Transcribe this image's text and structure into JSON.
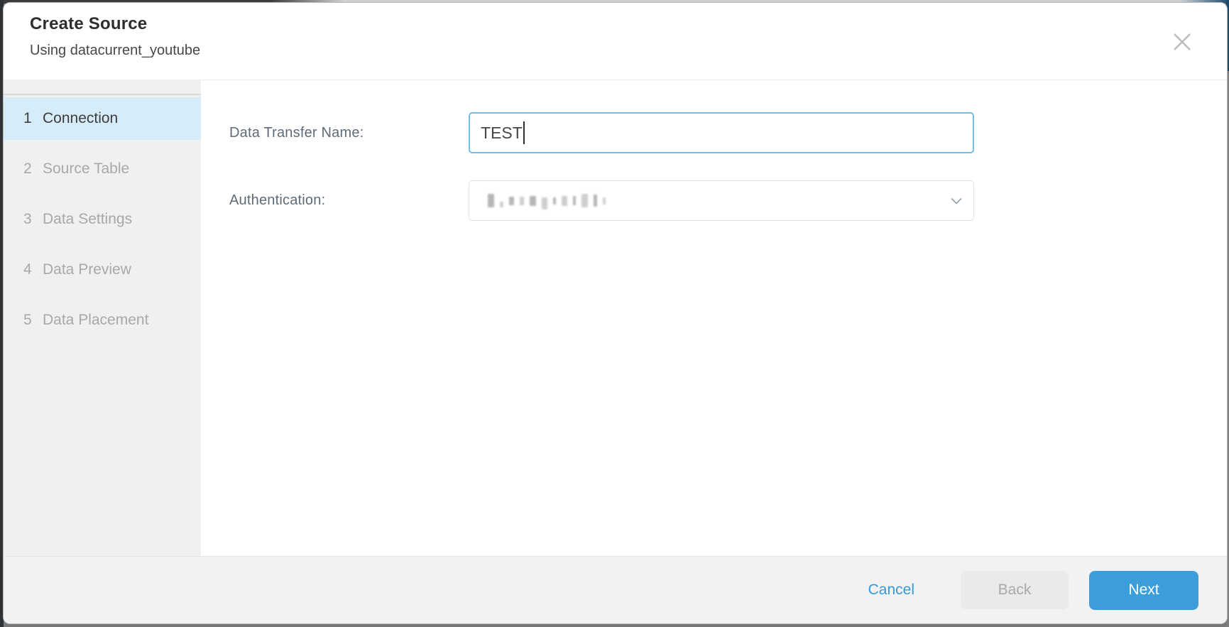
{
  "dialog": {
    "title": "Create Source",
    "subtitle": "Using datacurrent_youtube"
  },
  "steps": [
    {
      "number": "1",
      "label": "Connection",
      "state": "active"
    },
    {
      "number": "2",
      "label": "Source Table",
      "state": "upcoming"
    },
    {
      "number": "3",
      "label": "Data Settings",
      "state": "upcoming"
    },
    {
      "number": "4",
      "label": "Data Preview",
      "state": "upcoming"
    },
    {
      "number": "5",
      "label": "Data Placement",
      "state": "upcoming"
    }
  ],
  "form": {
    "data_transfer_name": {
      "label": "Data Transfer Name:",
      "value": "TEST",
      "focused": true
    },
    "authentication": {
      "label": "Authentication:",
      "value_redacted": true
    }
  },
  "footer": {
    "cancel_label": "Cancel",
    "back_label": "Back",
    "back_disabled": true,
    "next_label": "Next"
  },
  "icons": {
    "close": "close-icon",
    "chevron": "chevron-down-icon"
  },
  "colors": {
    "accent_blue": "#3598db",
    "next_button_bg": "#3b9edb",
    "active_step_bg": "#d7ecf9",
    "input_focus_border": "#74bde8",
    "sidebar_bg": "#f0f0f0",
    "footer_bg": "#f2f2f2"
  }
}
